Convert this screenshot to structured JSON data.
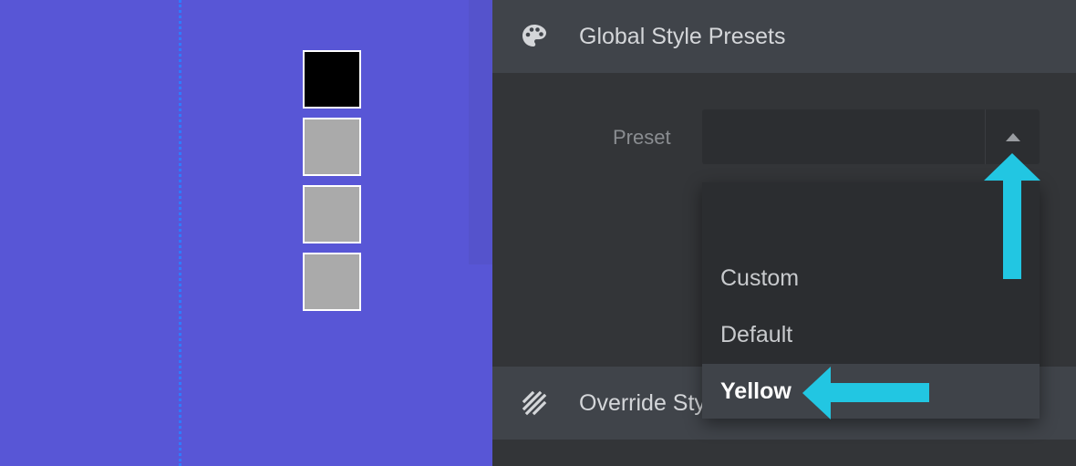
{
  "colors": {
    "canvas_bg": "#5856d6",
    "guide_line": "#2f7bff",
    "panel_bg": "#333538",
    "header_bg": "#40444a",
    "accent_arrow": "#22c6e2",
    "swatch_black": "#000000",
    "swatch_gray": "#aaaaaa"
  },
  "canvas": {
    "swatches": [
      {
        "color": "#000000"
      },
      {
        "color": "#aaaaaa"
      },
      {
        "color": "#aaaaaa"
      },
      {
        "color": "#aaaaaa"
      }
    ]
  },
  "panel": {
    "sections": [
      {
        "title": "Global Style Presets",
        "icon": "palette-icon"
      },
      {
        "title": "Override Styles",
        "icon": "hatch-stripes-icon"
      }
    ],
    "preset_field": {
      "label": "Preset",
      "value": ""
    },
    "dropdown": {
      "options": [
        "Custom",
        "Default",
        "Yellow"
      ],
      "highlighted": "Yellow"
    }
  }
}
